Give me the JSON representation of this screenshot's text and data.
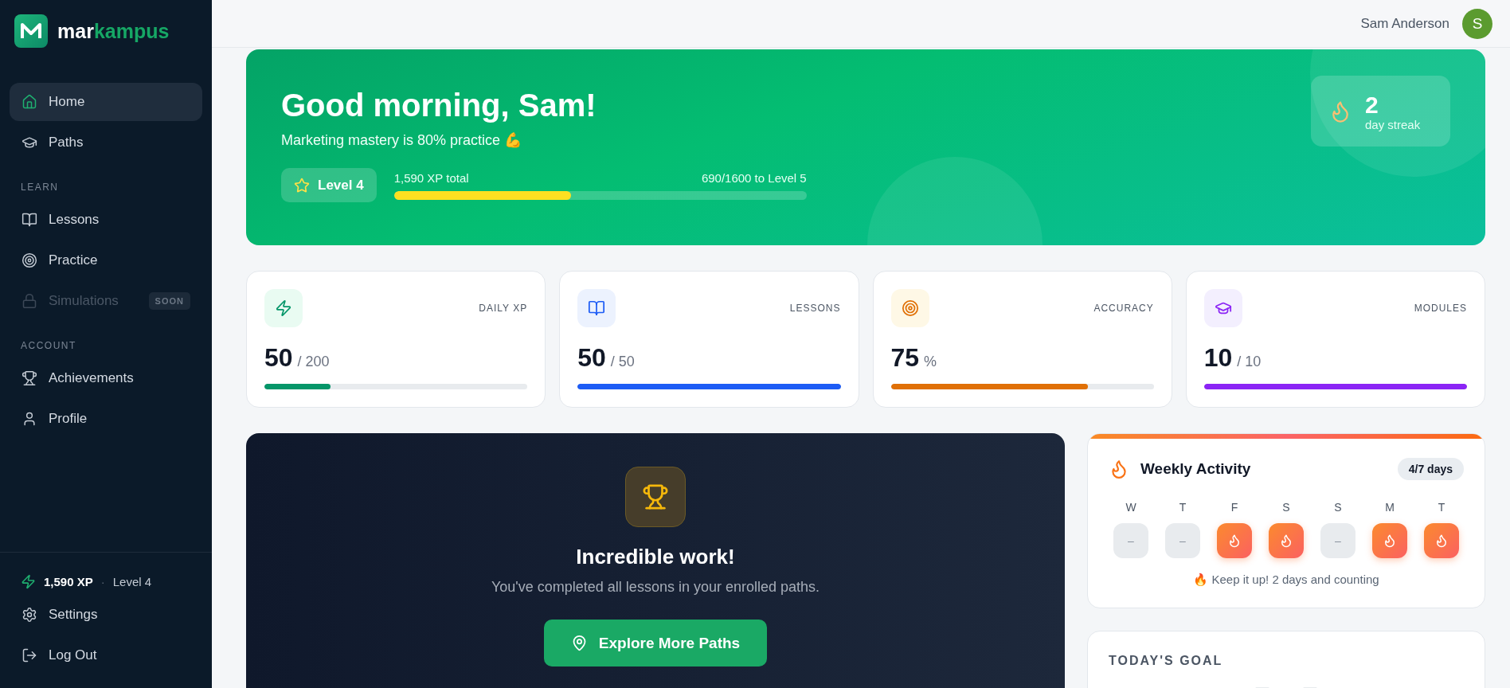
{
  "brand": {
    "prefix": "mar",
    "accent": "kampus"
  },
  "sidebar": {
    "items": [
      {
        "kind": "item",
        "label": "Home",
        "selected": true,
        "disabled": false
      },
      {
        "kind": "item",
        "label": "Paths",
        "selected": false,
        "disabled": false
      },
      {
        "kind": "section",
        "label": "LEARN"
      },
      {
        "kind": "item",
        "label": "Lessons",
        "selected": false,
        "disabled": false
      },
      {
        "kind": "item",
        "label": "Practice",
        "selected": false,
        "disabled": false
      },
      {
        "kind": "item",
        "label": "Simulations",
        "selected": false,
        "disabled": true,
        "badge": "SOON"
      },
      {
        "kind": "section",
        "label": "ACCOUNT"
      },
      {
        "kind": "item",
        "label": "Achievements",
        "selected": false,
        "disabled": false
      },
      {
        "kind": "item",
        "label": "Profile",
        "selected": false,
        "disabled": false
      }
    ],
    "footer": {
      "xp": "1,590 XP",
      "separator": "·",
      "level": "Level 4",
      "links": [
        {
          "label": "Settings"
        },
        {
          "label": "Log Out"
        }
      ]
    }
  },
  "header": {
    "user_name": "Sam Anderson",
    "avatar_initial": "S"
  },
  "hero": {
    "title": "Good morning, Sam!",
    "subtitle": "Marketing mastery is 80% practice 💪",
    "level_badge": "Level 4",
    "xp_total": "1,590 XP total",
    "xp_to_next": "690/1600 to Level 5",
    "level": 0.43,
    "streak": {
      "value": "2",
      "label": "day streak"
    }
  },
  "stats": [
    {
      "label": "DAILY XP",
      "value": "50",
      "unit": "/ 200",
      "level": 0.25,
      "color": "#059669"
    },
    {
      "label": "LESSONS",
      "value": "50",
      "unit": "/ 50",
      "level": 1,
      "color": "#1d5cf5"
    },
    {
      "label": "ACCURACY",
      "value": "75",
      "unit": "%",
      "level": 0.75,
      "color": "#e07006"
    },
    {
      "label": "MODULES",
      "value": "10",
      "unit": "/ 10",
      "level": 1,
      "color": "#8b24f5"
    }
  ],
  "completion": {
    "title": "Incredible work!",
    "text": "You've completed all lessons in your enrolled paths.",
    "button": "Explore More Paths"
  },
  "weekly": {
    "title": "Weekly Activity",
    "badge": "4/7 days",
    "days": [
      {
        "label": "W",
        "active": false,
        "empty_mark": "–"
      },
      {
        "label": "T",
        "active": false,
        "empty_mark": "–"
      },
      {
        "label": "F",
        "active": true
      },
      {
        "label": "S",
        "active": true
      },
      {
        "label": "S",
        "active": false,
        "empty_mark": "–"
      },
      {
        "label": "M",
        "active": true
      },
      {
        "label": "T",
        "active": true
      }
    ],
    "footer": "🔥 Keep it up! 2 days and counting"
  },
  "goal": {
    "title": "TODAY'S GOAL"
  }
}
